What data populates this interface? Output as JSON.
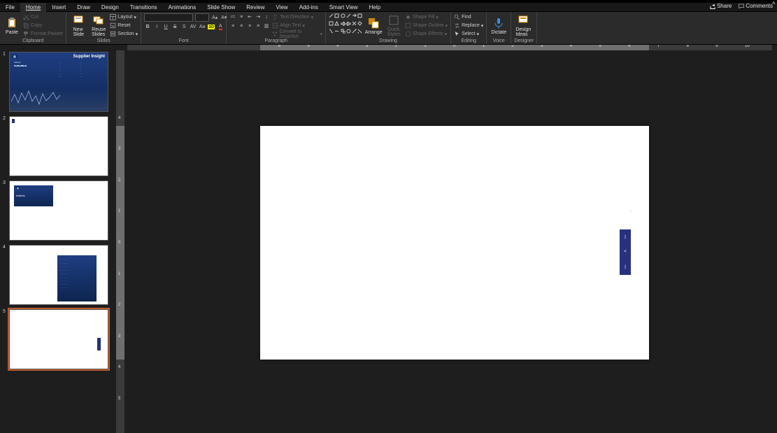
{
  "menu_tabs": [
    "File",
    "Home",
    "Insert",
    "Draw",
    "Design",
    "Transitions",
    "Animations",
    "Slide Show",
    "Review",
    "View",
    "Add-ins",
    "Smart View",
    "Help"
  ],
  "menu_active_index": 1,
  "titlebar_right": {
    "share": "Share",
    "comments": "Comments"
  },
  "ribbon": {
    "clipboard": {
      "paste": "Paste",
      "cut": "Cut",
      "copy": "Copy",
      "format_painter": "Format Painter",
      "label": "Clipboard"
    },
    "slides": {
      "new_slide": "New\nSlide",
      "reuse_slides": "Reuse\nSlides",
      "layout": "Layout",
      "reset": "Reset",
      "section": "Section",
      "label": "Slides"
    },
    "font": {
      "name_value": "",
      "size_value": "",
      "bold": "B",
      "italic": "I",
      "underline": "U",
      "strike": "S",
      "shadow": "S",
      "spacing": "AV",
      "case": "Aa",
      "label": "Font"
    },
    "paragraph": {
      "text_direction": "Text Direction",
      "align_text": "Align Text",
      "smartart": "Convert to SmartArt",
      "label": "Paragraph"
    },
    "drawing": {
      "arrange": "Arrange",
      "quick_styles": "Quick\nStyles",
      "shape_fill": "Shape Fill",
      "shape_outline": "Shape Outline",
      "shape_effects": "Shape Effects",
      "label": "Drawing"
    },
    "editing": {
      "find": "Find",
      "replace": "Replace",
      "select": "Select",
      "label": "Editing"
    },
    "voice": {
      "dictate": "Dictate",
      "label": "Voice"
    },
    "designer": {
      "design_ideas": "Design\nIdeas",
      "label": "Designer"
    }
  },
  "thumbnails": [
    {
      "n": "1",
      "type": "dashboard",
      "title": "Supplier Insight",
      "chip": "▦",
      "height": 86
    },
    {
      "n": "2",
      "type": "nearblank",
      "height": 86
    },
    {
      "n": "3",
      "type": "topleft",
      "height": 86
    },
    {
      "n": "4",
      "type": "centerpanel",
      "height": 86
    },
    {
      "n": "5",
      "type": "slide5",
      "height": 86
    }
  ],
  "slide5": {
    "obj_lines": [
      "|",
      "<",
      "|"
    ]
  },
  "accent_color": "#c05c2d"
}
